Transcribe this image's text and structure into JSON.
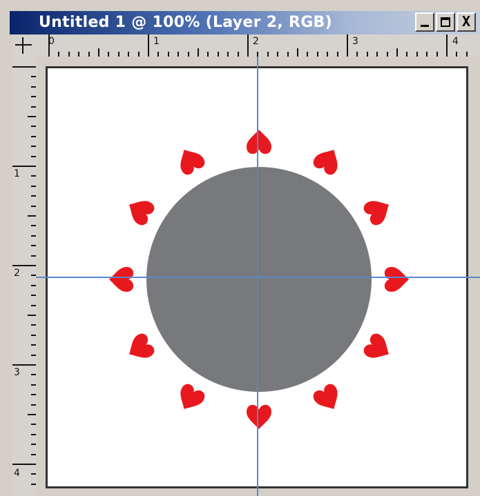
{
  "window": {
    "title": "Untitled 1 @ 100% (Layer 2, RGB)",
    "minimize_label": "",
    "maximize_label": "",
    "close_label": "X"
  },
  "rulers": {
    "horizontal_labels": [
      "0",
      "1",
      "2",
      "3",
      "4"
    ],
    "vertical_labels": [
      "1",
      "2",
      "3",
      "4"
    ]
  },
  "colors": {
    "circle": "#77797c",
    "heart": "#e8191e",
    "guide": "#5b86c9",
    "canvas": "#ffffff"
  },
  "icons": {
    "app": "document-icon",
    "heart": "heart-icon"
  }
}
